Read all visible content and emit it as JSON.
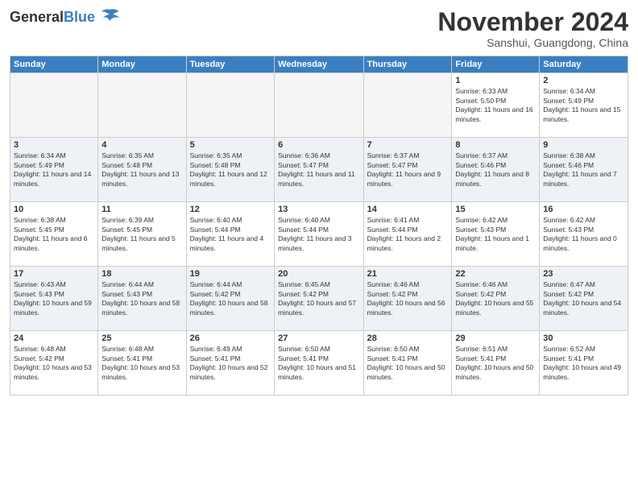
{
  "header": {
    "logo_general": "General",
    "logo_blue": "Blue",
    "month_title": "November 2024",
    "location": "Sanshui, Guangdong, China"
  },
  "weekdays": [
    "Sunday",
    "Monday",
    "Tuesday",
    "Wednesday",
    "Thursday",
    "Friday",
    "Saturday"
  ],
  "weeks": [
    [
      {
        "day": "",
        "sunrise": "",
        "sunset": "",
        "daylight": ""
      },
      {
        "day": "",
        "sunrise": "",
        "sunset": "",
        "daylight": ""
      },
      {
        "day": "",
        "sunrise": "",
        "sunset": "",
        "daylight": ""
      },
      {
        "day": "",
        "sunrise": "",
        "sunset": "",
        "daylight": ""
      },
      {
        "day": "",
        "sunrise": "",
        "sunset": "",
        "daylight": ""
      },
      {
        "day": "1",
        "sunrise": "Sunrise: 6:33 AM",
        "sunset": "Sunset: 5:50 PM",
        "daylight": "Daylight: 11 hours and 16 minutes."
      },
      {
        "day": "2",
        "sunrise": "Sunrise: 6:34 AM",
        "sunset": "Sunset: 5:49 PM",
        "daylight": "Daylight: 11 hours and 15 minutes."
      }
    ],
    [
      {
        "day": "3",
        "sunrise": "Sunrise: 6:34 AM",
        "sunset": "Sunset: 5:49 PM",
        "daylight": "Daylight: 11 hours and 14 minutes."
      },
      {
        "day": "4",
        "sunrise": "Sunrise: 6:35 AM",
        "sunset": "Sunset: 5:48 PM",
        "daylight": "Daylight: 11 hours and 13 minutes."
      },
      {
        "day": "5",
        "sunrise": "Sunrise: 6:35 AM",
        "sunset": "Sunset: 5:48 PM",
        "daylight": "Daylight: 11 hours and 12 minutes."
      },
      {
        "day": "6",
        "sunrise": "Sunrise: 6:36 AM",
        "sunset": "Sunset: 5:47 PM",
        "daylight": "Daylight: 11 hours and 11 minutes."
      },
      {
        "day": "7",
        "sunrise": "Sunrise: 6:37 AM",
        "sunset": "Sunset: 5:47 PM",
        "daylight": "Daylight: 11 hours and 9 minutes."
      },
      {
        "day": "8",
        "sunrise": "Sunrise: 6:37 AM",
        "sunset": "Sunset: 5:46 PM",
        "daylight": "Daylight: 11 hours and 8 minutes."
      },
      {
        "day": "9",
        "sunrise": "Sunrise: 6:38 AM",
        "sunset": "Sunset: 5:46 PM",
        "daylight": "Daylight: 11 hours and 7 minutes."
      }
    ],
    [
      {
        "day": "10",
        "sunrise": "Sunrise: 6:38 AM",
        "sunset": "Sunset: 5:45 PM",
        "daylight": "Daylight: 11 hours and 6 minutes."
      },
      {
        "day": "11",
        "sunrise": "Sunrise: 6:39 AM",
        "sunset": "Sunset: 5:45 PM",
        "daylight": "Daylight: 11 hours and 5 minutes."
      },
      {
        "day": "12",
        "sunrise": "Sunrise: 6:40 AM",
        "sunset": "Sunset: 5:44 PM",
        "daylight": "Daylight: 11 hours and 4 minutes."
      },
      {
        "day": "13",
        "sunrise": "Sunrise: 6:40 AM",
        "sunset": "Sunset: 5:44 PM",
        "daylight": "Daylight: 11 hours and 3 minutes."
      },
      {
        "day": "14",
        "sunrise": "Sunrise: 6:41 AM",
        "sunset": "Sunset: 5:44 PM",
        "daylight": "Daylight: 11 hours and 2 minutes."
      },
      {
        "day": "15",
        "sunrise": "Sunrise: 6:42 AM",
        "sunset": "Sunset: 5:43 PM",
        "daylight": "Daylight: 11 hours and 1 minute."
      },
      {
        "day": "16",
        "sunrise": "Sunrise: 6:42 AM",
        "sunset": "Sunset: 5:43 PM",
        "daylight": "Daylight: 11 hours and 0 minutes."
      }
    ],
    [
      {
        "day": "17",
        "sunrise": "Sunrise: 6:43 AM",
        "sunset": "Sunset: 5:43 PM",
        "daylight": "Daylight: 10 hours and 59 minutes."
      },
      {
        "day": "18",
        "sunrise": "Sunrise: 6:44 AM",
        "sunset": "Sunset: 5:43 PM",
        "daylight": "Daylight: 10 hours and 58 minutes."
      },
      {
        "day": "19",
        "sunrise": "Sunrise: 6:44 AM",
        "sunset": "Sunset: 5:42 PM",
        "daylight": "Daylight: 10 hours and 58 minutes."
      },
      {
        "day": "20",
        "sunrise": "Sunrise: 6:45 AM",
        "sunset": "Sunset: 5:42 PM",
        "daylight": "Daylight: 10 hours and 57 minutes."
      },
      {
        "day": "21",
        "sunrise": "Sunrise: 6:46 AM",
        "sunset": "Sunset: 5:42 PM",
        "daylight": "Daylight: 10 hours and 56 minutes."
      },
      {
        "day": "22",
        "sunrise": "Sunrise: 6:46 AM",
        "sunset": "Sunset: 5:42 PM",
        "daylight": "Daylight: 10 hours and 55 minutes."
      },
      {
        "day": "23",
        "sunrise": "Sunrise: 6:47 AM",
        "sunset": "Sunset: 5:42 PM",
        "daylight": "Daylight: 10 hours and 54 minutes."
      }
    ],
    [
      {
        "day": "24",
        "sunrise": "Sunrise: 6:48 AM",
        "sunset": "Sunset: 5:42 PM",
        "daylight": "Daylight: 10 hours and 53 minutes."
      },
      {
        "day": "25",
        "sunrise": "Sunrise: 6:48 AM",
        "sunset": "Sunset: 5:41 PM",
        "daylight": "Daylight: 10 hours and 53 minutes."
      },
      {
        "day": "26",
        "sunrise": "Sunrise: 6:49 AM",
        "sunset": "Sunset: 5:41 PM",
        "daylight": "Daylight: 10 hours and 52 minutes."
      },
      {
        "day": "27",
        "sunrise": "Sunrise: 6:50 AM",
        "sunset": "Sunset: 5:41 PM",
        "daylight": "Daylight: 10 hours and 51 minutes."
      },
      {
        "day": "28",
        "sunrise": "Sunrise: 6:50 AM",
        "sunset": "Sunset: 5:41 PM",
        "daylight": "Daylight: 10 hours and 50 minutes."
      },
      {
        "day": "29",
        "sunrise": "Sunrise: 6:51 AM",
        "sunset": "Sunset: 5:41 PM",
        "daylight": "Daylight: 10 hours and 50 minutes."
      },
      {
        "day": "30",
        "sunrise": "Sunrise: 6:52 AM",
        "sunset": "Sunset: 5:41 PM",
        "daylight": "Daylight: 10 hours and 49 minutes."
      }
    ]
  ]
}
